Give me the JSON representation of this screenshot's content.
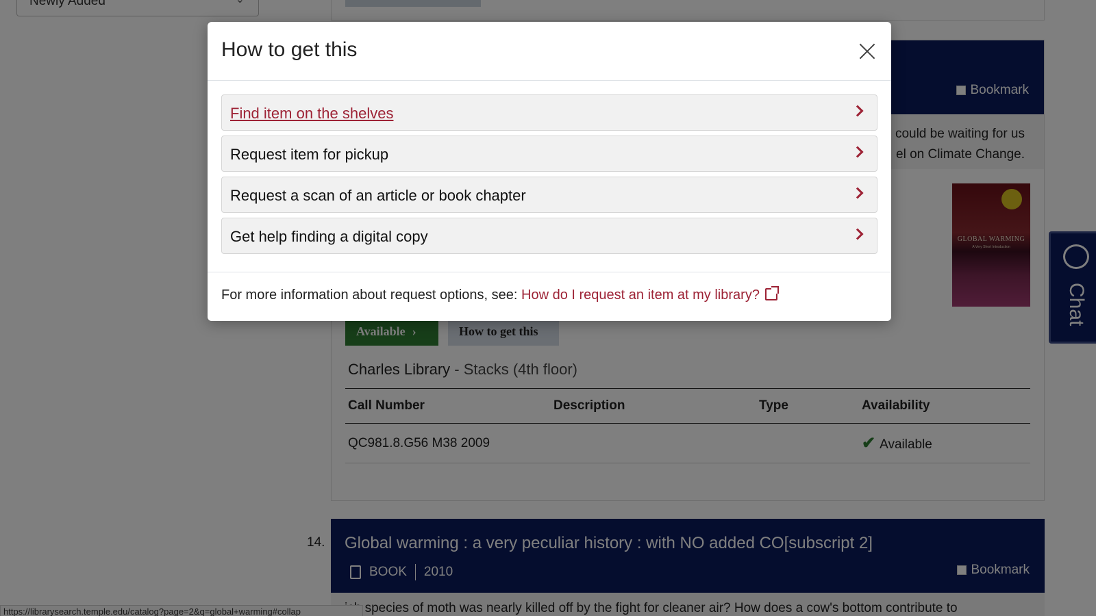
{
  "background": {
    "sort_value": "Newly Added",
    "record13": {
      "bookmark_label": "Bookmark",
      "summary_line1": "could be waiting for us",
      "summary_line2": "el on Climate Change.",
      "cover_title": "GLOBAL WARMING",
      "cover_subtitle": "A Very Short Introduction",
      "available_label": "Available",
      "howto_label": "How to get this",
      "location_library": "Charles Library",
      "location_sub": " - Stacks (4th floor)",
      "table": {
        "headers": [
          "Call Number",
          "Description",
          "Type",
          "Availability"
        ],
        "rows": [
          {
            "call_number": "QC981.8.G56 M38 2009",
            "description": "",
            "type": "",
            "availability": "Available"
          }
        ]
      }
    },
    "record14": {
      "number": "14.",
      "title": "Global warming : a very peculiar history : with NO added CO[subscript 2]",
      "format": "BOOK",
      "year": "2010",
      "bookmark_label": "Bookmark",
      "summary": "ich species of moth was nearly killed off by the fight for cleaner air? How does a cow's bottom contribute to"
    },
    "chat_label": "Chat",
    "status_url": "https://librarysearch.temple.edu/catalog?page=2&q=global+warming#collap"
  },
  "modal": {
    "title": "How to get this",
    "options": [
      {
        "label": "Find item on the shelves"
      },
      {
        "label": "Request item for pickup"
      },
      {
        "label": "Request a scan of an article or book chapter"
      },
      {
        "label": "Get help finding a digital copy"
      }
    ],
    "footer_text": "For more information about request options, see: ",
    "footer_link": "How do I request an item at my library?"
  },
  "colors": {
    "accent": "#9d2235",
    "header_navy": "#0b1a5c",
    "available_green": "#2e7d32"
  }
}
